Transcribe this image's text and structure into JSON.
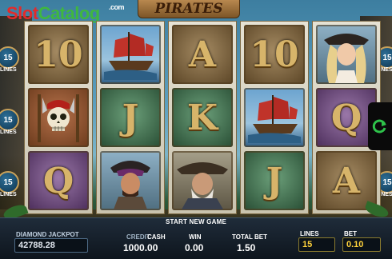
{
  "brand": {
    "slot": "Slot",
    "catalog": "Catalog",
    "com": ".com"
  },
  "game_title": "PIRATES",
  "line_badges": {
    "number": "15",
    "caption": "LINES"
  },
  "reels": [
    [
      {
        "type": "letter",
        "text": "10",
        "tone": "wood"
      },
      {
        "type": "pirate-skull",
        "text": "",
        "tone": "rust"
      },
      {
        "type": "letter",
        "text": "Q",
        "tone": "purple"
      }
    ],
    [
      {
        "type": "ship",
        "text": "",
        "tone": "sky"
      },
      {
        "type": "letter",
        "text": "J",
        "tone": "jade"
      },
      {
        "type": "pirate-man",
        "text": "",
        "tone": "portrait"
      }
    ],
    [
      {
        "type": "letter",
        "text": "A",
        "tone": "wood"
      },
      {
        "type": "letter",
        "text": "K",
        "tone": "jade"
      },
      {
        "type": "captain",
        "text": "",
        "tone": "pirate2"
      }
    ],
    [
      {
        "type": "letter",
        "text": "10",
        "tone": "wood"
      },
      {
        "type": "ship",
        "text": "",
        "tone": "sky"
      },
      {
        "type": "letter",
        "text": "J",
        "tone": "jade"
      }
    ],
    [
      {
        "type": "pirate-woman",
        "text": "",
        "tone": "portrait"
      },
      {
        "type": "letter",
        "text": "Q",
        "tone": "purple"
      },
      {
        "type": "letter",
        "text": "A",
        "tone": "wood"
      }
    ]
  ],
  "status_message": "START NEW GAME",
  "jackpot": {
    "label": "DIAMOND JACKPOT",
    "value": "42788.28"
  },
  "credit": {
    "label_credit": "CREDIT",
    "label_cash": "CASH",
    "value": "1000.00"
  },
  "win": {
    "label": "WIN",
    "value": "0.00"
  },
  "total_bet": {
    "label": "TOTAL BET",
    "value": "1.50"
  },
  "lines": {
    "label": "LINES",
    "value": "15"
  },
  "bet": {
    "label": "BET",
    "value": "0.10"
  },
  "colors": {
    "accent_yellow": "#ffd23b",
    "badge_blue": "#0c3450",
    "spin_green": "#2ec24a"
  },
  "icons": {
    "spin": "refresh-arrow-icon"
  }
}
